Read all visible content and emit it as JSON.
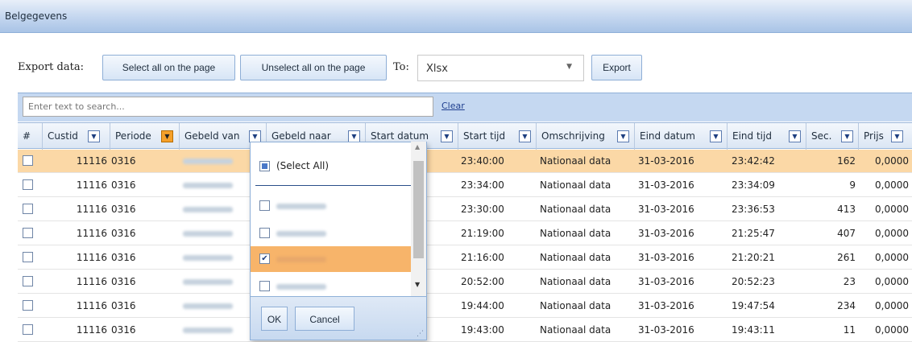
{
  "window": {
    "title": "Belgegevens"
  },
  "export": {
    "label": "Export data:",
    "select_all": "Select all on the page",
    "unselect_all": "Unselect all on the page",
    "to_label": "To:",
    "format": "Xlsx",
    "export_button": "Export"
  },
  "search": {
    "placeholder": "Enter text to search...",
    "clear": "Clear"
  },
  "columns": [
    "#",
    "Custid",
    "Periode",
    "Gebeld van",
    "Gebeld naar",
    "Start datum",
    "Start tijd",
    "Omschrijving",
    "Eind datum",
    "Eind tijd",
    "Sec.",
    "Prijs"
  ],
  "filter_icon": "dropdown-arrow-icon",
  "rows": [
    {
      "custid": "11116",
      "periode": "0316",
      "start_tijd": "23:40:00",
      "omschrijving": "Nationaal data",
      "eind_datum": "31-03-2016",
      "eind_tijd": "23:42:42",
      "sec": "162",
      "prijs": "0,0000"
    },
    {
      "custid": "11116",
      "periode": "0316",
      "start_tijd": "23:34:00",
      "omschrijving": "Nationaal data",
      "eind_datum": "31-03-2016",
      "eind_tijd": "23:34:09",
      "sec": "9",
      "prijs": "0,0000"
    },
    {
      "custid": "11116",
      "periode": "0316",
      "start_tijd": "23:30:00",
      "omschrijving": "Nationaal data",
      "eind_datum": "31-03-2016",
      "eind_tijd": "23:36:53",
      "sec": "413",
      "prijs": "0,0000"
    },
    {
      "custid": "11116",
      "periode": "0316",
      "start_tijd": "21:19:00",
      "omschrijving": "Nationaal data",
      "eind_datum": "31-03-2016",
      "eind_tijd": "21:25:47",
      "sec": "407",
      "prijs": "0,0000"
    },
    {
      "custid": "11116",
      "periode": "0316",
      "start_tijd": "21:16:00",
      "omschrijving": "Nationaal data",
      "eind_datum": "31-03-2016",
      "eind_tijd": "21:20:21",
      "sec": "261",
      "prijs": "0,0000"
    },
    {
      "custid": "11116",
      "periode": "0316",
      "start_tijd": "20:52:00",
      "omschrijving": "Nationaal data",
      "eind_datum": "31-03-2016",
      "eind_tijd": "20:52:23",
      "sec": "23",
      "prijs": "0,0000"
    },
    {
      "custid": "11116",
      "periode": "0316",
      "start_tijd": "19:44:00",
      "omschrijving": "Nationaal data",
      "eind_datum": "31-03-2016",
      "eind_tijd": "19:47:54",
      "sec": "234",
      "prijs": "0,0000"
    },
    {
      "custid": "11116",
      "periode": "0316",
      "start_tijd": "19:43:00",
      "omschrijving": "Nationaal data",
      "eind_datum": "31-03-2016",
      "eind_tijd": "19:43:11",
      "sec": "11",
      "prijs": "0,0000"
    }
  ],
  "filter_dropdown": {
    "select_all": "(Select All)",
    "ok": "OK",
    "cancel": "Cancel"
  },
  "colors": {
    "selected_row": "#fbd8a6",
    "active_filter": "#f5a02a",
    "header_band": "#c5d8f1"
  }
}
